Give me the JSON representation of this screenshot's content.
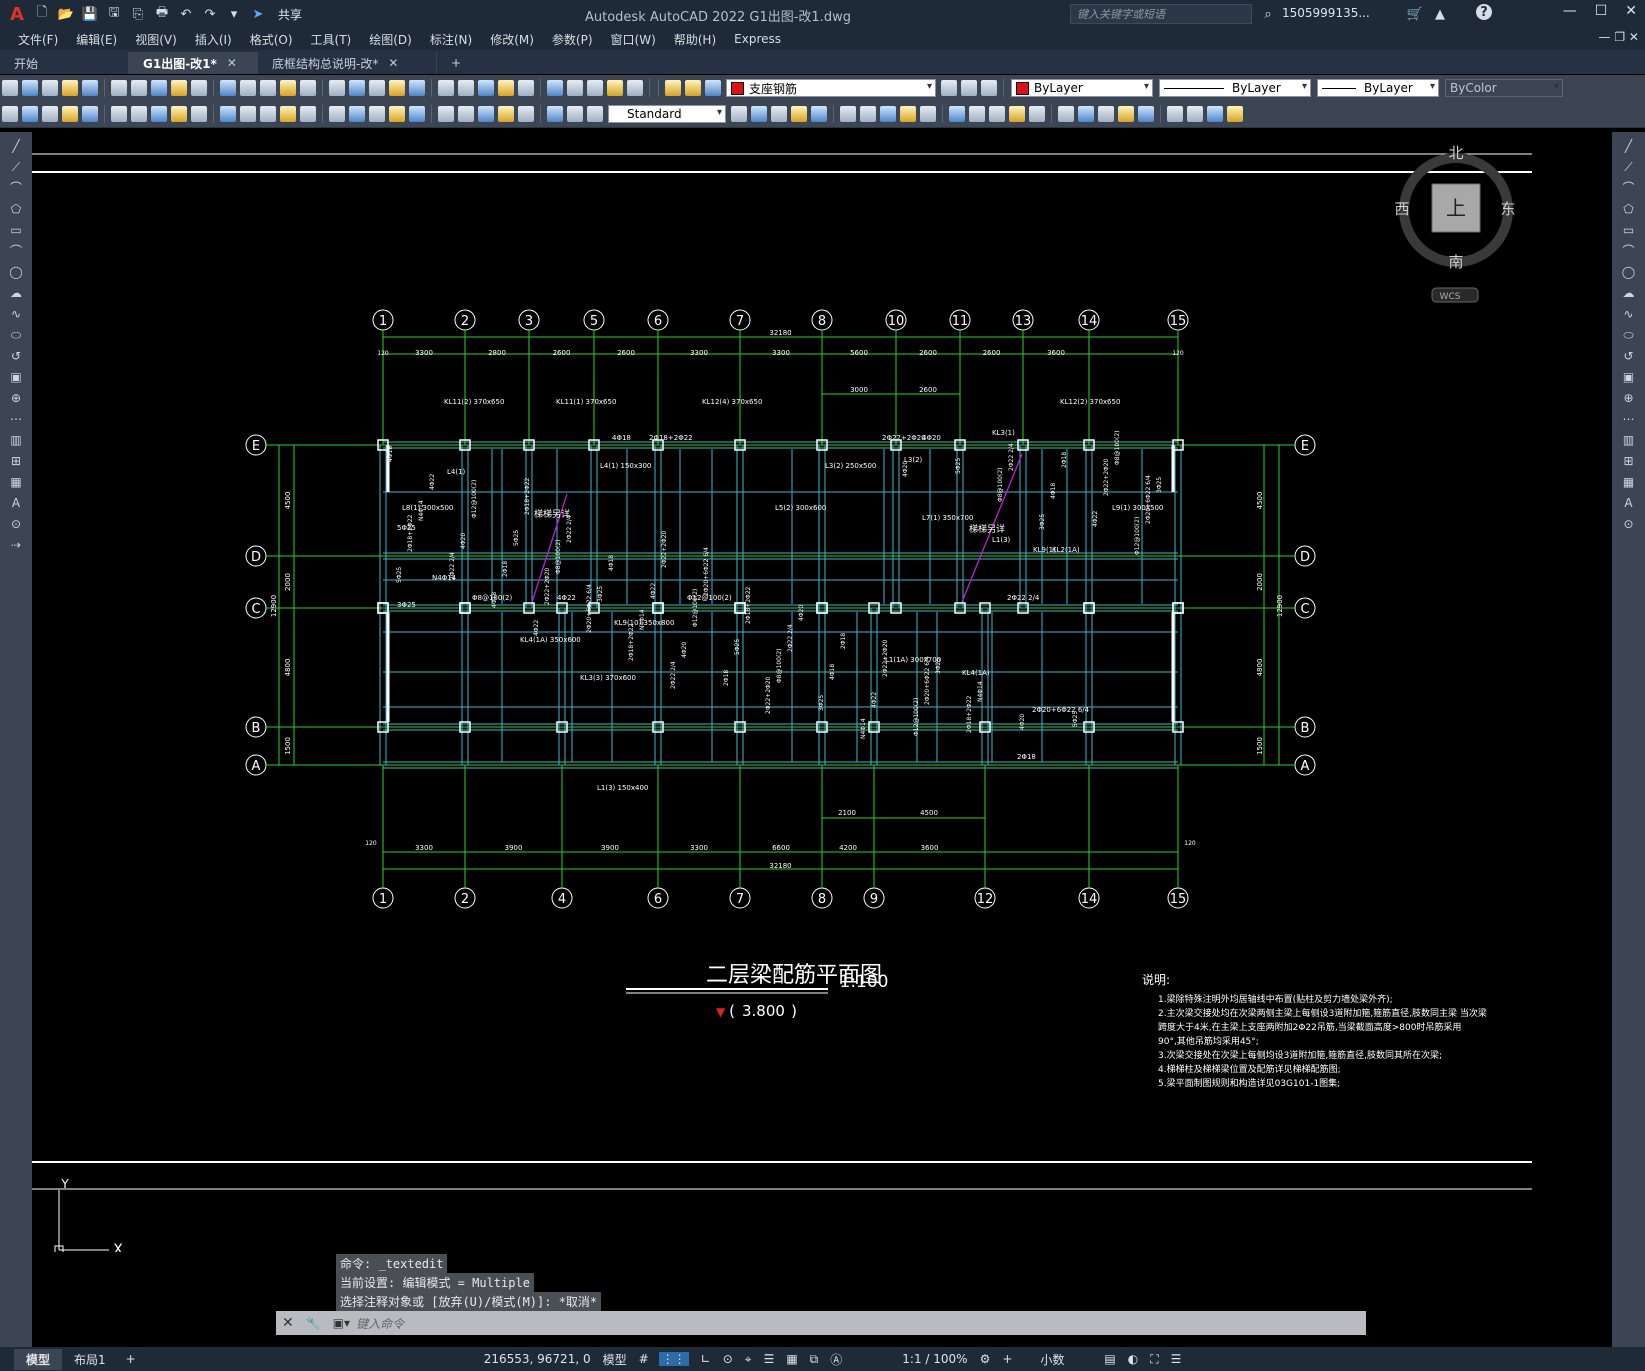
{
  "titlebar": {
    "logo": "A",
    "share_label": "共享",
    "app_title": "Autodesk AutoCAD 2022    G1出图-改1.dwg",
    "search_placeholder": "键入关键字或短语",
    "username": "1505999135...",
    "help": "?"
  },
  "menu": {
    "items": [
      "文件(F)",
      "编辑(E)",
      "视图(V)",
      "插入(I)",
      "格式(O)",
      "工具(T)",
      "绘图(D)",
      "标注(N)",
      "修改(M)",
      "参数(P)",
      "窗口(W)",
      "帮助(H)",
      "Express"
    ]
  },
  "tabs": [
    {
      "label": "开始",
      "active": false,
      "closable": false
    },
    {
      "label": "G1出图-改1*",
      "active": true,
      "closable": true
    },
    {
      "label": "底框结构总说明-改*",
      "active": false,
      "closable": true
    }
  ],
  "toolbar1": {
    "layer_name": "支座钢筋",
    "color_value": "ByLayer",
    "linetype_value": "ByLayer",
    "lineweight_value": "ByLayer",
    "plotstyle_value": "ByColor"
  },
  "toolbar2": {
    "textstyle_value": "Standard"
  },
  "viewcube": {
    "north": "北",
    "south": "南",
    "east": "东",
    "west": "西",
    "face": "上",
    "wcs": "WCS"
  },
  "drawing": {
    "axes_top": [
      "1",
      "2",
      "3",
      "5",
      "6",
      "7",
      "8",
      "10",
      "11",
      "13",
      "14",
      "15"
    ],
    "axes_bottom": [
      "1",
      "2",
      "4",
      "6",
      "7",
      "8",
      "9",
      "12",
      "14",
      "15"
    ],
    "axes_rows": [
      "E",
      "D",
      "C",
      "B",
      "A"
    ],
    "top_total": "32180",
    "top_dims": [
      "3300",
      "2800",
      "2600",
      "2600",
      "3300",
      "3300",
      "5600",
      "2600",
      "2600",
      "3600"
    ],
    "top_inner_dims": [
      "3000",
      "2600"
    ],
    "bottom_total": "32180",
    "bottom_dims": [
      "3300",
      "3900",
      "3900",
      "3300",
      "6600",
      "4200",
      "3600"
    ],
    "bottom_inner_dims": [
      "2100",
      "4500"
    ],
    "left_dims": [
      "4500",
      "2000",
      "4800",
      "1500"
    ],
    "left_total": "12900",
    "end_dim": "120",
    "beam_labels": [
      "KL11(2) 370x650",
      "KL11(1) 370x650",
      "KL12(4) 370x650",
      "KL12(2) 370x650",
      "L4(1) 150x300",
      "L3(2) 250x500",
      "L8(1) 300x500",
      "L9(1) 300x500",
      "L5(2) 300x600",
      "KL9(10) 350x800",
      "KL4(1A) 350x600",
      "KL3(3) 370x600",
      "L1(3) 150x400",
      "L1(1A) 300x700",
      "KL4(1A)",
      "KL3(1)",
      "KL9(1)",
      "KL2(1A)",
      "L4(1)",
      "L3(2)",
      "L7(1) 350x700",
      "L1(3)"
    ],
    "rebar_labels": [
      "4Φ18",
      "2Φ18+2Φ22",
      "2Φ22+2Φ20",
      "4Φ20",
      "3Φ25",
      "5Φ25",
      "4Φ22",
      "2Φ22 2/4",
      "2Φ20+6Φ22 6/4",
      "2Φ18",
      "N4Φ14",
      "Φ8@100(2)",
      "Φ12@100(2)"
    ],
    "stair_label": "梯梯另详",
    "title": "二层梁配筋平面图",
    "scale": "1:100",
    "elevation": "3.800",
    "notes_title": "说明:",
    "notes": [
      "1.梁除特殊注明外均居轴线中布置(贴柱及剪力墙处梁外齐);",
      "2.主次梁交接处均在次梁两侧主梁上每侧设3道附加箍,箍筋直径,肢数同主梁 当次梁",
      "  跨度大于4米,在主梁上支座两附加2Φ22吊筋,当梁截面高度>800时吊筋采用",
      "  90°,其他吊筋均采用45°;",
      "3.次梁交接处在次梁上每侧均设3道附加箍,箍筋直径,肢数同其所在次梁;",
      "4.梯梯柱及梯梯梁位置及配筋详见梯梯配筋图;",
      "5.梁平面制图规则和构造详见03G101-1图集;"
    ]
  },
  "command": {
    "history": [
      "命令: _textedit",
      "当前设置: 编辑模式 = Multiple",
      "选择注释对象或 [放弃(U)/模式(M)]: *取消*"
    ],
    "placeholder": "键入命令"
  },
  "ucs": {
    "x": "X",
    "y": "Y"
  },
  "status": {
    "layout_tabs": [
      "模型",
      "布局1"
    ],
    "coords": "216553, 96721, 0",
    "space": "模型",
    "annotation_scale": "1:1 / 100%",
    "units": "小数"
  },
  "colors": {
    "grid_green": "#23d623",
    "beam_cyan": "#3fb7c6",
    "text_white": "#ffffff",
    "title_bg": "#1f2a38",
    "toolbar_bg": "#3b4553"
  }
}
